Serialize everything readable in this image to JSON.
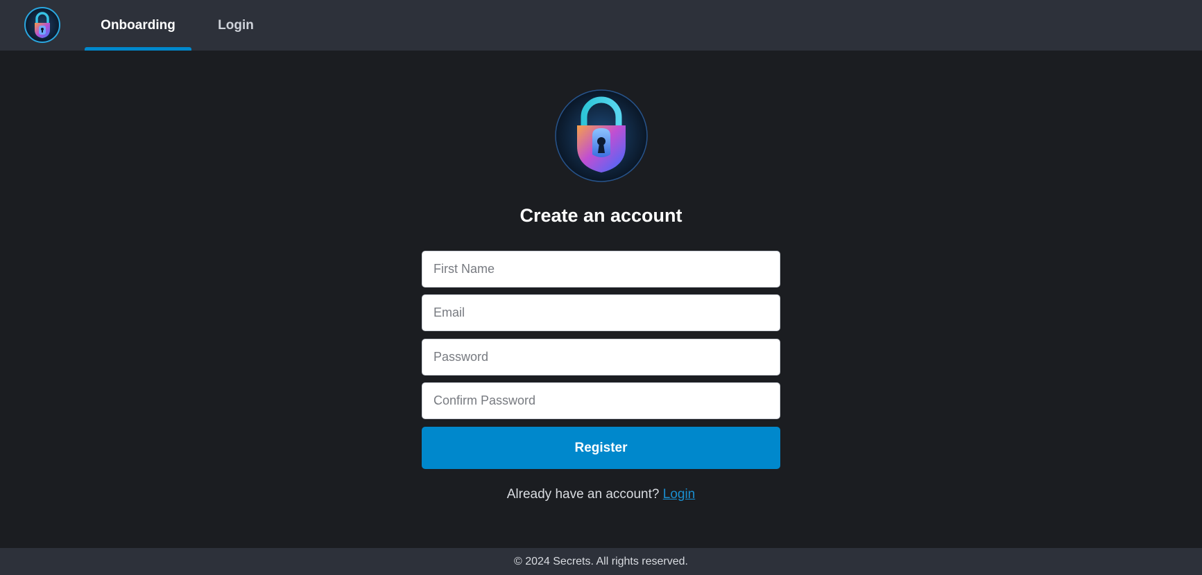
{
  "app": {
    "logo_icon": "padlock-icon"
  },
  "nav": {
    "tabs": [
      {
        "label": "Onboarding",
        "active": true
      },
      {
        "label": "Login",
        "active": false
      }
    ],
    "accent_color": "#0088cc"
  },
  "main": {
    "hero_icon": "padlock-icon",
    "title": "Create an account",
    "fields": {
      "first_name": {
        "placeholder": "First Name",
        "value": ""
      },
      "email": {
        "placeholder": "Email",
        "value": ""
      },
      "password": {
        "placeholder": "Password",
        "value": ""
      },
      "confirm_password": {
        "placeholder": "Confirm Password",
        "value": ""
      }
    },
    "register_label": "Register",
    "already_text": "Already have an account?",
    "login_link": "Login"
  },
  "footer": {
    "text": "© 2024 Secrets. All rights reserved."
  },
  "colors": {
    "background": "#1b1d21",
    "nav_background": "#2d313a",
    "primary": "#0088cc",
    "link": "#1a8fd1"
  }
}
